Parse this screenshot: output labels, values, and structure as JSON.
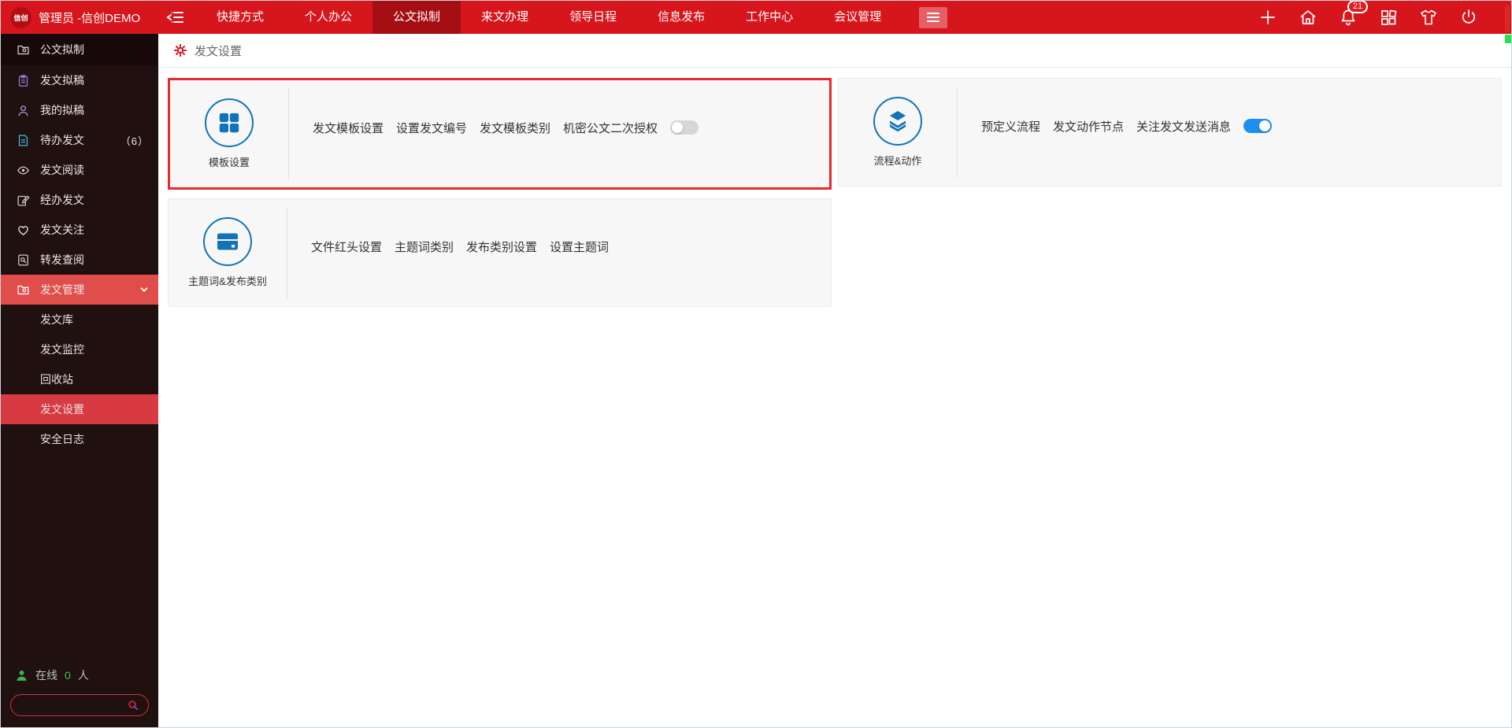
{
  "topbar": {
    "logo_text": "信创",
    "user_label": "管理员 -信创DEMO",
    "tabs": [
      {
        "label": "快捷方式",
        "active": false
      },
      {
        "label": "个人办公",
        "active": false
      },
      {
        "label": "公文拟制",
        "active": true
      },
      {
        "label": "来文办理",
        "active": false
      },
      {
        "label": "领导日程",
        "active": false
      },
      {
        "label": "信息发布",
        "active": false
      },
      {
        "label": "工作中心",
        "active": false
      },
      {
        "label": "会议管理",
        "active": false
      }
    ],
    "notification_count": "21"
  },
  "sidebar": {
    "items": [
      {
        "label": "公文拟制",
        "icon": "folder-doc-icon"
      },
      {
        "label": "发文拟稿",
        "icon": "clipboard-icon"
      },
      {
        "label": "我的拟稿",
        "icon": "user-icon"
      },
      {
        "label": "待办发文",
        "icon": "file-icon",
        "count": "（6）"
      },
      {
        "label": "发文阅读",
        "icon": "eye-icon"
      },
      {
        "label": "经办发文",
        "icon": "edit-icon"
      },
      {
        "label": "发文关注",
        "icon": "heart-icon"
      },
      {
        "label": "转发查阅",
        "icon": "doc-search-icon"
      },
      {
        "label": "发文管理",
        "icon": "folder-icon",
        "expanded": true
      }
    ],
    "submenu": [
      {
        "label": "发文库",
        "active": false
      },
      {
        "label": "发文监控",
        "active": false
      },
      {
        "label": "回收站",
        "active": false
      },
      {
        "label": "发文设置",
        "active": true
      },
      {
        "label": "安全日志",
        "active": false
      }
    ],
    "online": {
      "label": "在线",
      "count": "0",
      "suffix": "人"
    },
    "search_placeholder": ""
  },
  "breadcrumb": {
    "title": "发文设置"
  },
  "cards": [
    {
      "name": "模板设置",
      "icon": "grid-squares-icon",
      "highlighted": true,
      "links": [
        "发文模板设置",
        "设置发文编号",
        "发文模板类别",
        "机密公文二次授权"
      ],
      "toggle": "off"
    },
    {
      "name": "流程&动作",
      "icon": "layers-icon",
      "highlighted": false,
      "links": [
        "预定义流程",
        "发文动作节点",
        "关注发文发送消息"
      ],
      "toggle": "on"
    },
    {
      "name": "主题词&发布类别",
      "icon": "credit-card-icon",
      "highlighted": false,
      "links": [
        "文件红头设置",
        "主题词类别",
        "发布类别设置",
        "设置主题词"
      ],
      "toggle": null
    }
  ],
  "colors": {
    "topbar_red": "#d6161c",
    "active_tab_red": "#a50e13",
    "sidebar_bg": "#201010",
    "sidebar_active_red": "#d73a40",
    "highlight_border_red": "#e52c2c",
    "icon_blue": "#1273b8",
    "toggle_on_blue": "#1e8ff0",
    "online_green": "#2fd04a"
  }
}
